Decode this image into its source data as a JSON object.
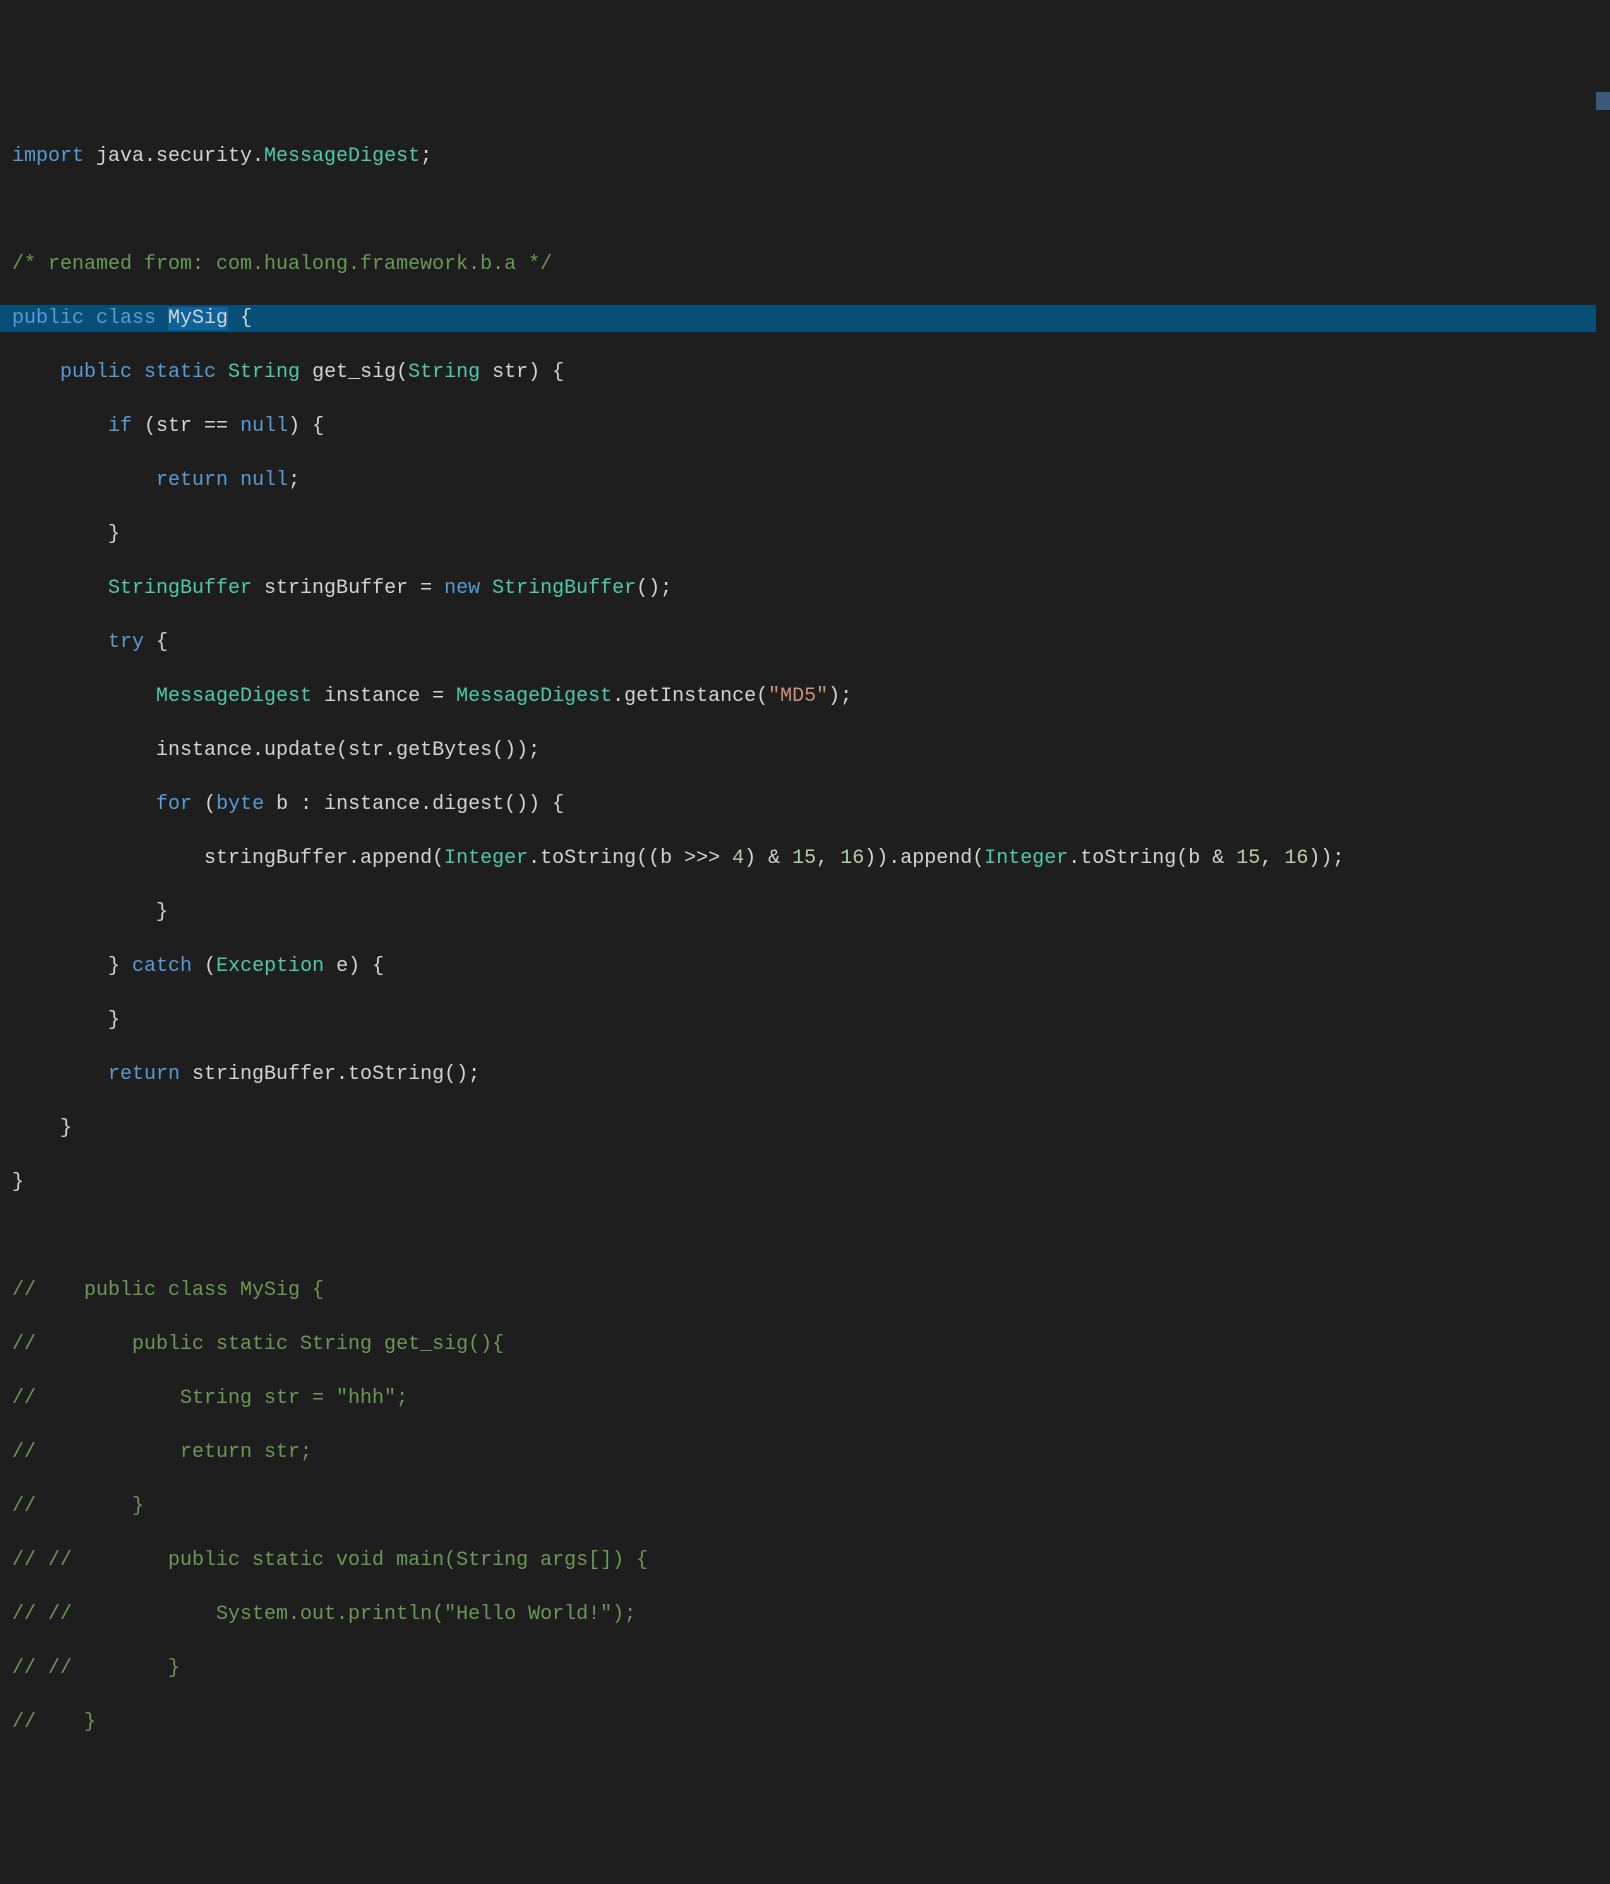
{
  "code": {
    "line1": {
      "import_kw": "import",
      "package": " java.security.",
      "class": "MessageDigest",
      "semi": ";"
    },
    "line3": {
      "comment": "/* renamed from: com.hualong.framework.b.a */"
    },
    "line4": {
      "public_kw": "public",
      "class_kw": " class ",
      "name": "MySig",
      "brace": " {"
    },
    "line5": {
      "indent": "    ",
      "public_kw": "public",
      "static_kw": " static ",
      "ret_type": "String",
      "method": " get_sig",
      "paren_o": "(",
      "param_type": "String",
      "param": " str",
      "paren_c": ") {"
    },
    "line6": {
      "indent": "        ",
      "if_kw": "if",
      "cond_o": " (str == ",
      "null_kw": "null",
      "cond_c": ") {"
    },
    "line7": {
      "indent": "            ",
      "return_kw": "return",
      "space": " ",
      "null_kw": "null",
      "semi": ";"
    },
    "line8": {
      "indent": "        ",
      "brace": "}"
    },
    "line9": {
      "indent": "        ",
      "type1": "StringBuffer",
      "var": " stringBuffer = ",
      "new_kw": "new",
      "space": " ",
      "type2": "StringBuffer",
      "call": "();"
    },
    "line10": {
      "indent": "        ",
      "try_kw": "try",
      "brace": " {"
    },
    "line11": {
      "indent": "            ",
      "type": "MessageDigest",
      "var": " instance = ",
      "class": "MessageDigest",
      "method": ".getInstance(",
      "str": "\"MD5\"",
      "end": ");"
    },
    "line12": {
      "indent": "            ",
      "call": "instance.update(str.getBytes());"
    },
    "line13": {
      "indent": "            ",
      "for_kw": "for",
      "paren": " (",
      "byte_kw": "byte",
      "var": " b : instance.digest()) {"
    },
    "line14": {
      "indent": "                ",
      "pre": "stringBuffer.append(",
      "int1": "Integer",
      "mid1": ".toString((b >>> ",
      "n4": "4",
      "mid2": ") & ",
      "n15a": "15",
      "mid3": ", ",
      "n16a": "16",
      "mid4": ")).append(",
      "int2": "Integer",
      "mid5": ".toString(b & ",
      "n15b": "15",
      "mid6": ", ",
      "n16b": "16",
      "end": "));"
    },
    "line15": {
      "indent": "            ",
      "brace": "}"
    },
    "line16": {
      "indent": "        ",
      "brace_c": "} ",
      "catch_kw": "catch",
      "paren_o": " (",
      "exc_type": "Exception",
      "var": " e) {"
    },
    "line17": {
      "indent": "        ",
      "brace": "}"
    },
    "line18": {
      "indent": "        ",
      "return_kw": "return",
      "expr": " stringBuffer.toString();"
    },
    "line19": {
      "indent": "    ",
      "brace": "}"
    },
    "line20": {
      "brace": "}"
    },
    "line22": {
      "comment": "//    public class MySig {"
    },
    "line23": {
      "comment": "//        public static String get_sig(){"
    },
    "line24": {
      "comment": "//            String str = \"hhh\";"
    },
    "line25": {
      "comment": "//            return str;"
    },
    "line26": {
      "comment": "//        }"
    },
    "line27": {
      "comment": "// //        public static void main(String args[]) {"
    },
    "line28": {
      "comment": "// //            System.out.println(\"Hello World!\");"
    },
    "line29": {
      "comment": "// //        }"
    },
    "line30": {
      "comment": "//    }"
    }
  }
}
